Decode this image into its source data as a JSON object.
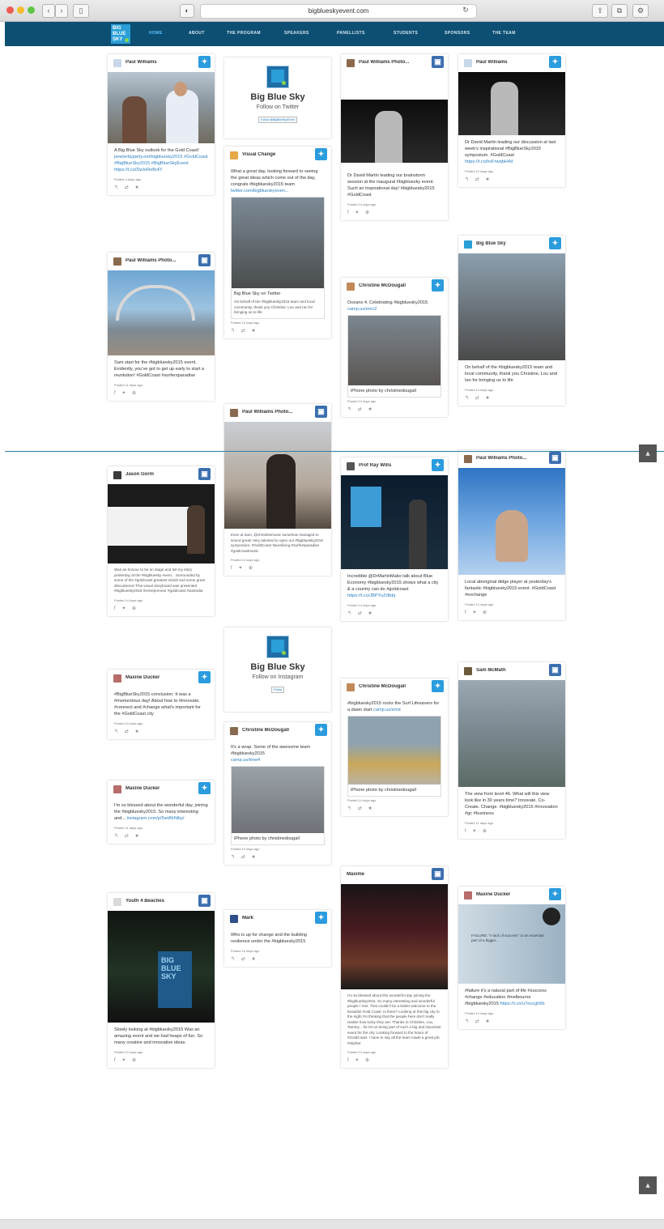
{
  "browser": {
    "url": "bigblueskyevent.com"
  },
  "nav": {
    "items": [
      "HOME",
      "ABOUT",
      "THE PROGRAM",
      "SPEAKERS",
      "PANELLISTS",
      "STUDENTS",
      "SPONSORS",
      "THE TEAM"
    ],
    "active_color": "#5ec3ff"
  },
  "colors": {
    "nav_bg": "#0d4f73",
    "twitter": "#2b9cdd",
    "facebook": "#3b6fb0",
    "link": "#2b7fc1"
  },
  "col1": [
    {
      "author": "Paul Williams",
      "source": "twitter",
      "text": "A Big Blue Sky outlook for the Gold Coast!",
      "links": "pewterbyparty.net/bigbluesky2015 #GoldCoast #BigBlueSky2015 #BigBlueSkyEvent https://t.co/DwIoReBcFf",
      "meta": "Posted 4 days ago"
    },
    {
      "author": "Paul Williams Photo...",
      "source": "instagram",
      "text": "Sam start for the #bigbluesky2015 event. Evidently, you've got to get up early to start a revolution! #GoldCoast #surfersparadise",
      "meta": "Posted 11 days ago"
    },
    {
      "author": "Jason Gorm",
      "source": "instagram",
      "text": "Was an honour to be on stage and tell my story yesterday at the #bigbluesky event... Surrounded by some of the #goldcoast greatest minds and some great discussions! This visual storyboard was presented #bigbluesky2015 #entrepreneur #goldcoast #australia",
      "meta": "Posted 14 days ago"
    },
    {
      "author": "Maxine Ducker",
      "source": "twitter",
      "text": "#BigBlueSky2015 conclusion: It was a #momentous day! About how to #innovate, #connect and #change what's important for the #GoldCoast city",
      "meta": "Posted 10 days ago"
    },
    {
      "author": "Maxine Ducker",
      "source": "twitter",
      "text": "I'm so blessed about the wonderful day, joining the #bigbluesky2015. So many interesting and...",
      "link": "instagram.com/p/5wd0rNiby/",
      "meta": "Posted 11 days ago"
    },
    {
      "author": "Youth 4 Beaches",
      "source": "instagram",
      "text": "Slowly looking at #bigbluesky2015 Was an amazing event and we had heaps of fun. So many creative and innovative ideas.",
      "meta": "Posted 10 days ago"
    }
  ],
  "col2": [
    {
      "type": "follow",
      "title": "Big Blue Sky",
      "subtitle": "Follow on Twitter",
      "button": "Follow @BigBlueSkyEvent"
    },
    {
      "author": "Visual Change",
      "source": "twitter",
      "text": "What a great day, looking forward to seeing the great ideas which come out of the day, congrats #bigbluesky2015 team",
      "link": "twitter.com/bigblueskyeven...",
      "inner_title": "Big Blue Sky on Twitter",
      "inner_text": "On behalf of the #bigbluesky2015 team and local community, thank you Christine, Lou and Ian for bringing us to life",
      "meta": "Posted 14 days ago"
    },
    {
      "author": "Paul Williams Photo...",
      "source": "instagram",
      "text": "Even at 5am, @christinemusic somehow managed to sound great! Very talented to open our #bigbluesky2015 symposium. #GoldCoast #pureliving #surfersparadise #goldcoastmusic",
      "meta": "Posted 14 days ago"
    },
    {
      "type": "follow",
      "title": "Big Blue Sky",
      "subtitle": "Follow on Instagram",
      "button": "Follow"
    },
    {
      "author": "Christine McDougall",
      "source": "twitter",
      "text": "It's a wrap. Some of the awesome team #bigbluesky2015",
      "link": "camp.us/tmw4",
      "inner_title": "iPhone photo by christinedougall",
      "meta": "Posted 10 days ago"
    },
    {
      "author": "Mark",
      "source": "twitter",
      "text": "Who is up for change and the building resilience under the #bigbluesky2015",
      "meta": "Posted 16 days ago"
    }
  ],
  "col3": [
    {
      "author": "Paul Williams Photo...",
      "source": "instagram",
      "text": "Dr David Martin leading our brainstorm session at the inaugural #bigbluesky event. Such an inspirational day! #bigbluesky2015 #GoldCoast",
      "meta": "Posted 14 days ago"
    },
    {
      "author": "Christine McDougall",
      "source": "twitter",
      "text": "Oceans 4. Celebrating #bigbluesky2015",
      "link": "camp.us/emc2",
      "inner_title": "iPhone photo by christinedougall",
      "meta": "Posted 14 days ago"
    },
    {
      "author": "Prof Ray Wills",
      "source": "twitter",
      "text": "Incredible @DrMartinMako talk about Blue Economy #bigbluesky2015 shows what a city & a country can do #goldcoast",
      "link": "https://t.co/JBPYuZrBdq",
      "meta": "Posted 14 days ago"
    },
    {
      "author": "Christine McDougall",
      "source": "twitter",
      "text": "#bigbluesky2015 rocks the Surf Lifesavers for a dawn start",
      "link": "camp.us/emd",
      "inner_title": "iPhone photo by christinedougall",
      "meta": "Posted 14 days ago"
    },
    {
      "author": "Maxime",
      "source": "instagram",
      "text": "I'm so blessed about this wonderful day joining the #bigbluesky2015. So many interesting and wonderful people I met. That couldn't be a better welcome to the beautiful Gold Coast. Is there? Looking at this big city to the night I'm thinking that the people here don't really realise how lucky they are. Thanks to Christine, Lou, Tammy... for let us being part of such a big and important event for the city. Looking forward to the future of #GoldCoast. I have to say all the team made a great job #skyline",
      "meta": "Posted 14 days ago"
    }
  ],
  "col4": [
    {
      "author": "Paul Williams",
      "source": "twitter",
      "text": "Dr David Martin leading our discussion at last week's inspirational #BigBlueSky2015 symposium. #GoldCoast",
      "link": "https://t.co/hxFrwqbH4d",
      "meta": "Posted 12 days ago"
    },
    {
      "author": "Big Blue Sky",
      "source": "twitter",
      "text": "On behalf of the #bigbluesky2015 team and local community, thank you Christine, Lou and Ian for bringing us to life",
      "meta": "Posted 14 days ago"
    },
    {
      "author": "Paul Williams Photo...",
      "source": "instagram",
      "text": "Local aboriginal didge player at yesterday's fantastic #bigbluesky2015 event. #GoldCoast #exchange",
      "meta": "Posted 14 days ago"
    },
    {
      "author": "Sam McMath",
      "source": "instagram",
      "text": "The view from level 46. What will this view look like in 30 years time? Innovate. Co-Create. Change. #bigbluesky2015 #innovation #gc #business",
      "meta": "Posted 11 days ago"
    },
    {
      "author": "Maxine Ducker",
      "source": "twitter",
      "text": "#failure it's a natural part of life #success #change #education #melbourne #bigbluesky2015",
      "link": "https://t.co/u7eucgh6b",
      "inner_quote": "FAILURE: \"A lack of success\" or an essential part of a bigger...",
      "meta": "Posted 14 days ago"
    }
  ],
  "icons": {
    "twitter": "twitter-icon",
    "instagram": "instagram-icon",
    "reply": "reply-icon",
    "retweet": "retweet-icon",
    "favorite": "favorite-icon"
  }
}
